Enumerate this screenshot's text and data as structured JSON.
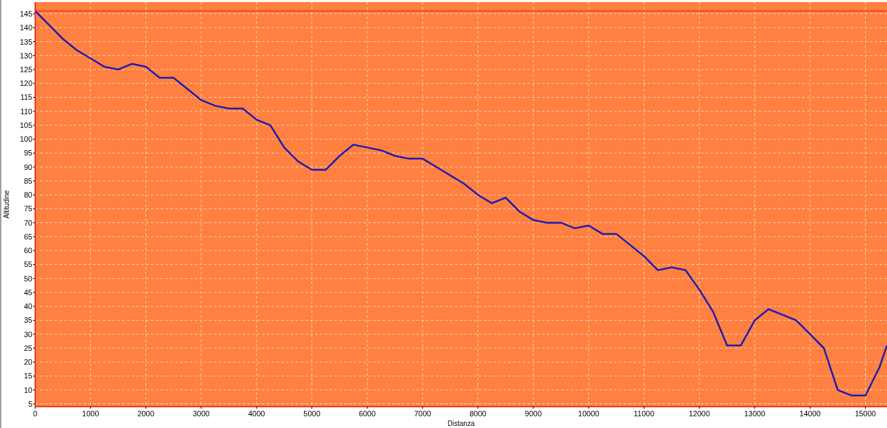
{
  "chart": {
    "chart_data": {
      "type": "line",
      "xlabel": "Distanza",
      "ylabel": "Altitudine",
      "x": [
        0,
        250,
        500,
        750,
        1000,
        1250,
        1500,
        1750,
        2000,
        2250,
        2500,
        2750,
        3000,
        3250,
        3500,
        3750,
        4000,
        4250,
        4500,
        4750,
        5000,
        5250,
        5500,
        5750,
        6000,
        6250,
        6500,
        6750,
        7000,
        7250,
        7500,
        7750,
        8000,
        8250,
        8500,
        8750,
        9000,
        9250,
        9500,
        9750,
        10000,
        10250,
        10500,
        10750,
        11000,
        11250,
        11500,
        11750,
        12000,
        12250,
        12500,
        12750,
        13000,
        13250,
        13500,
        13750,
        14000,
        14250,
        14500,
        14750,
        15000,
        15250,
        15390
      ],
      "series": [
        {
          "color": "#1a1ab4",
          "values": [
            146,
            141,
            136,
            132,
            129,
            126,
            125,
            127,
            126,
            122,
            122,
            118,
            114,
            112,
            111,
            111,
            107,
            105,
            97,
            92,
            89,
            89,
            94,
            98,
            97,
            96,
            94,
            93,
            93,
            90,
            87,
            84,
            80,
            77,
            79,
            74,
            71,
            70,
            70,
            68,
            69,
            66,
            66,
            62,
            58,
            53,
            54,
            53,
            46,
            38,
            26,
            26,
            35,
            39,
            37,
            35,
            30,
            25,
            10,
            8,
            8,
            18,
            26
          ]
        },
        {
          "color": "#e01010",
          "values": [
            146,
            146,
            146,
            146,
            146,
            146,
            146,
            146,
            146,
            146,
            146,
            146,
            146,
            146,
            146,
            146,
            146,
            146,
            146,
            146,
            146,
            146,
            146,
            146,
            146,
            146,
            146,
            146,
            146,
            146,
            146,
            146,
            146,
            146,
            146,
            146,
            146,
            146,
            146,
            146,
            146,
            146,
            146,
            146,
            146,
            146,
            146,
            146,
            146,
            146,
            146,
            146,
            146,
            146,
            146,
            146,
            146,
            146,
            146,
            146,
            146,
            146,
            146
          ]
        }
      ],
      "xlim": [
        0,
        15390
      ],
      "ylim": [
        4,
        149.2
      ],
      "xticks": [
        0,
        1000,
        2000,
        3000,
        4000,
        5000,
        6000,
        7000,
        8000,
        9000,
        10000,
        11000,
        12000,
        13000,
        14000,
        15000
      ],
      "grid": true,
      "yticks": [
        5,
        10,
        15,
        20,
        25,
        30,
        35,
        40,
        45,
        50,
        55,
        60,
        65,
        70,
        75,
        80,
        85,
        90,
        95,
        100,
        105,
        110,
        115,
        120,
        125,
        130,
        135,
        140,
        145
      ]
    }
  }
}
